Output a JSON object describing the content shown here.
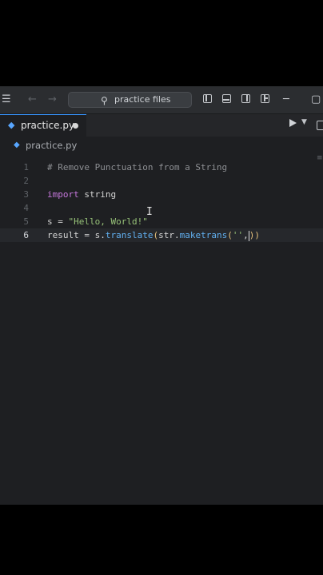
{
  "titlebar": {
    "search_text": "practice files",
    "icons": [
      "menu-icon",
      "back-arrow-icon",
      "forward-arrow-icon",
      "search-icon",
      "toggle-primary-sidebar-icon",
      "toggle-panel-icon",
      "toggle-secondary-sidebar-icon",
      "customize-layout-icon",
      "minimize-icon",
      "maximize-icon"
    ],
    "glyphs": {
      "menu": "☰",
      "back": "←",
      "forward": "→",
      "search": "⚲",
      "minimize": "─",
      "maximize": "▢"
    }
  },
  "tab": {
    "filename": "practice.py",
    "py_glyph": "◆",
    "modified": true
  },
  "breadcrumb": {
    "file": "practice.py"
  },
  "editor": {
    "current_line": 6,
    "lines": [
      {
        "n": "1",
        "tokens": [
          {
            "t": "# Remove Punctuation from a String",
            "c": "c-comment"
          }
        ]
      },
      {
        "n": "2",
        "tokens": []
      },
      {
        "n": "3",
        "tokens": [
          {
            "t": "import",
            "c": "c-kw"
          },
          {
            "t": " string",
            "c": ""
          }
        ]
      },
      {
        "n": "4",
        "tokens": []
      },
      {
        "n": "5",
        "tokens": [
          {
            "t": "s = ",
            "c": ""
          },
          {
            "t": "\"Hello, World!\"",
            "c": "c-str"
          }
        ]
      },
      {
        "n": "6",
        "tokens": [
          {
            "t": "result = s.",
            "c": ""
          },
          {
            "t": "translate",
            "c": "c-fn"
          },
          {
            "t": "(",
            "c": "c-paren"
          },
          {
            "t": "str",
            "c": ""
          },
          {
            "t": ".",
            "c": ""
          },
          {
            "t": "maketrans",
            "c": "c-fn"
          },
          {
            "t": "(",
            "c": "c-paren"
          },
          {
            "t": "''",
            "c": "c-str"
          },
          {
            "t": ",",
            "c": ""
          },
          {
            "t": ")",
            "c": "c-paren"
          },
          {
            "t": ")",
            "c": "c-paren"
          }
        ]
      }
    ]
  },
  "colors": {
    "background": "#1e1f22",
    "titlebar": "#2b2d30",
    "accent": "#3794ff",
    "python_icon": "#58a6ff"
  }
}
